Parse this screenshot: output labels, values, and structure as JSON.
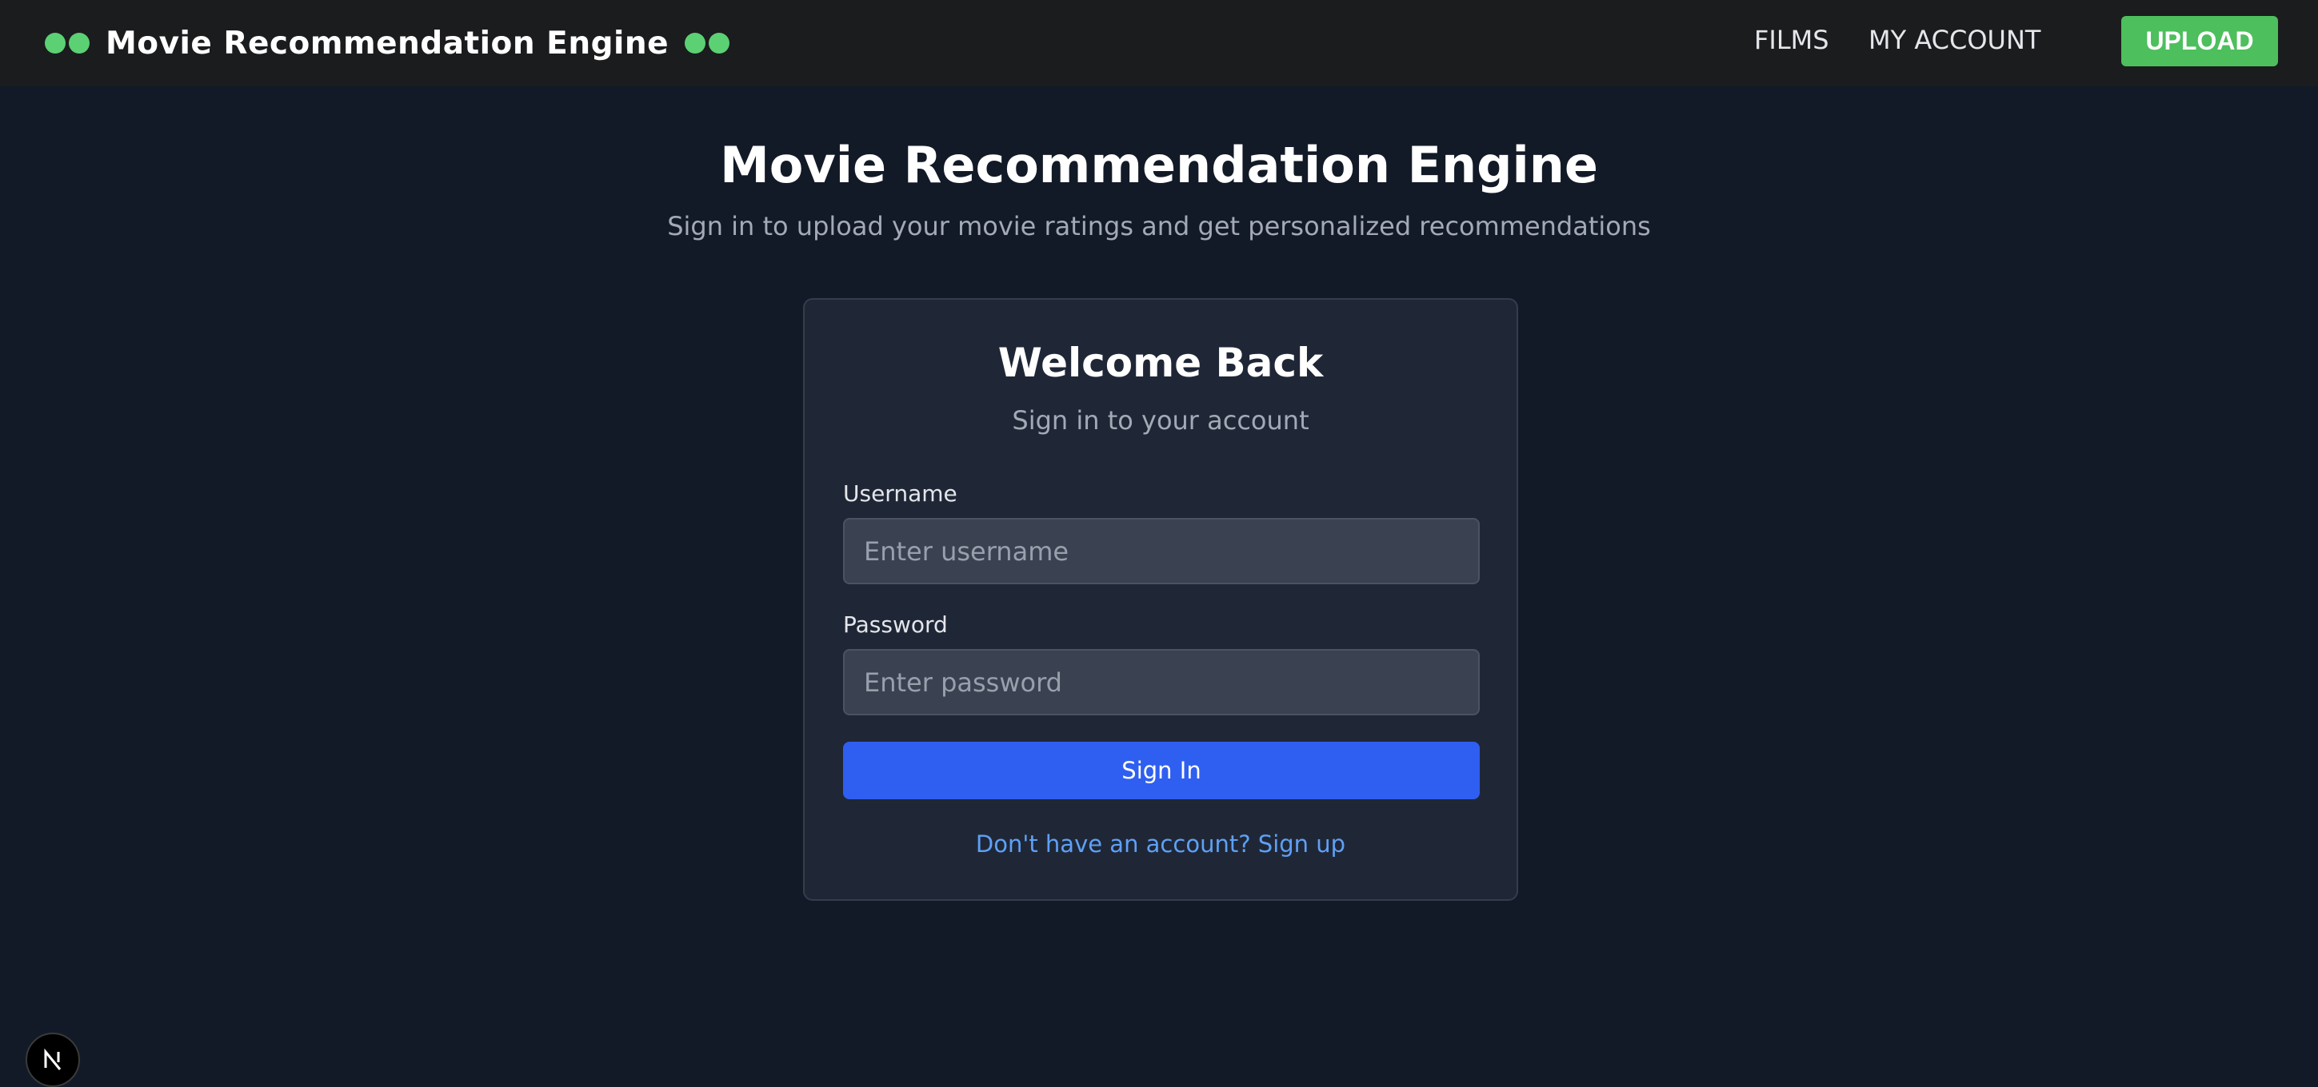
{
  "header": {
    "brand_title": "Movie Recommendation Engine",
    "nav": [
      {
        "label": "FILMS"
      },
      {
        "label": "MY ACCOUNT"
      }
    ],
    "upload_label": "UPLOAD"
  },
  "hero": {
    "title": "Movie Recommendation Engine",
    "subtitle": "Sign in to upload your movie ratings and get personalized recommendations"
  },
  "login_card": {
    "title": "Welcome Back",
    "subtitle": "Sign in to your account",
    "username_label": "Username",
    "username_placeholder": "Enter username",
    "username_value": "",
    "password_label": "Password",
    "password_placeholder": "Enter password",
    "password_value": "",
    "submit_label": "Sign In",
    "signup_link": "Don't have an account? Sign up"
  },
  "badges": {
    "framework_icon": "nextjs-logo-icon"
  },
  "colors": {
    "background": "#131a27",
    "header_bg": "#1b1c1e",
    "accent_green": "#4dbf5d",
    "primary_blue": "#2f5ff0",
    "link_blue": "#5fa0f5"
  }
}
